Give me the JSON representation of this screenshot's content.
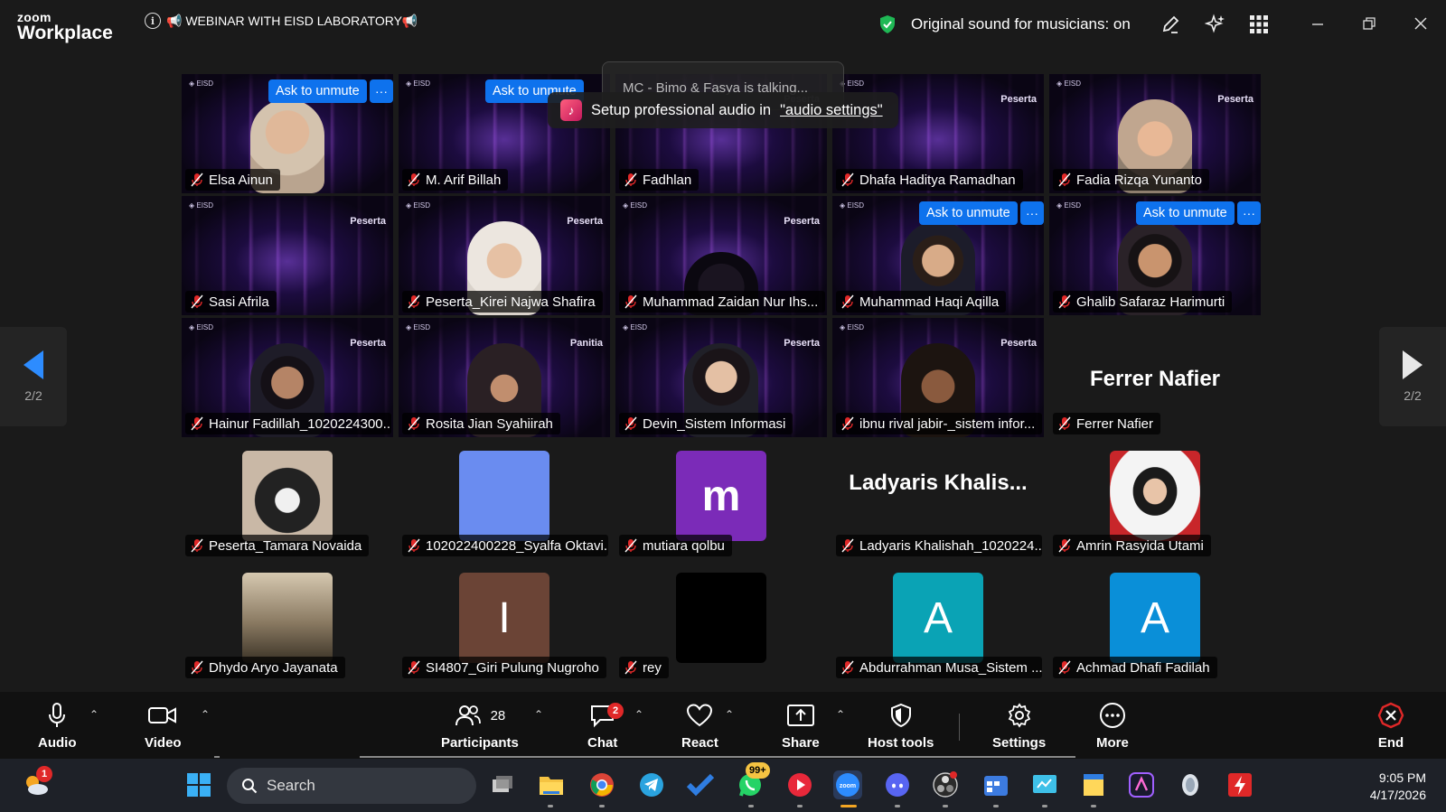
{
  "app": {
    "brand_top": "zoom",
    "brand_bottom": "Workplace"
  },
  "meeting": {
    "title": "📢 WEBINAR WITH EISD LABORATORY📢",
    "sound_status": "Original sound for musicians: on"
  },
  "tile_labels": {
    "brand": "Peserta",
    "brand_alt": "Panitia",
    "ask": "Ask to unmute",
    "more": "···"
  },
  "grid": [
    {
      "name": "Elsa Ainun",
      "ask": true
    },
    {
      "name": "M. Arif Billah",
      "ask": true
    },
    {
      "name": "Fadhlan",
      "ask": false
    },
    {
      "name": "Dhafa Haditya Ramadhan",
      "ask": false
    },
    {
      "name": "Fadia Rizqa Yunanto",
      "ask": false
    },
    {
      "name": "Sasi Afrila",
      "ask": false
    },
    {
      "name": "Peserta_Kirei Najwa Shafira",
      "ask": false
    },
    {
      "name": "Muhammad Zaidan Nur Ihs...",
      "ask": false
    },
    {
      "name": "Muhammad Haqi Aqilla",
      "ask": true
    },
    {
      "name": "Ghalib Safaraz Harimurti",
      "ask": true
    },
    {
      "name": "Hainur Fadillah_1020224300...",
      "ask": false
    },
    {
      "name": "Rosita Jian Syahiirah",
      "ask": false
    },
    {
      "name": "Devin_Sistem Informasi",
      "ask": false
    },
    {
      "name": "ibnu rival jabir-_sistem infor...",
      "ask": false
    },
    {
      "name": "Ferrer Nafier",
      "ask": false,
      "display_name": "Ferrer Nafier"
    }
  ],
  "avatars": [
    {
      "name": "Peserta_Tamara Novaida",
      "letter": "",
      "color": "#6b5a4a"
    },
    {
      "name": "102022400228_Syalfa Oktavi...",
      "letter": "",
      "color": "#6a8cf0"
    },
    {
      "name": "mutiara qolbu",
      "letter": "m",
      "color": "#7b2bb8"
    },
    {
      "name": "Ladyaris Khalishah_1020224...",
      "letter": "",
      "color": "",
      "display_name": "Ladyaris  Khalis..."
    },
    {
      "name": "Amrin Rasyida Utami",
      "letter": "",
      "color": "#c8262a"
    },
    {
      "name": "Dhydo Aryo Jayanata",
      "letter": "",
      "color": "#8a7a62"
    },
    {
      "name": "SI4807_Giri Pulung Nugroho",
      "letter": "I",
      "color": "#6b4436"
    },
    {
      "name": "rey",
      "letter": "",
      "color": "#000000"
    },
    {
      "name": "Abdurrahman Musa_Sistem ...",
      "letter": "A",
      "color": "#0aa3b5"
    },
    {
      "name": "Achmad Dhafi Fadilah",
      "letter": "A",
      "color": "#0a8fd8"
    }
  ],
  "pager": {
    "left": "2/2",
    "right": "2/2"
  },
  "toasts": {
    "talking": "MC - Bimo & Fasya is talking...",
    "audio_prefix": "Setup professional audio in",
    "audio_link": "\"audio settings\""
  },
  "toolbar": {
    "audio": "Audio",
    "video": "Video",
    "participants": "Participants",
    "participants_count": "28",
    "chat": "Chat",
    "chat_badge": "2",
    "react": "React",
    "share": "Share",
    "host_tools": "Host tools",
    "settings": "Settings",
    "more": "More",
    "end": "End"
  },
  "taskbar": {
    "search_placeholder": "Search",
    "time": "9:05 PM",
    "date": "4/17/2026",
    "weather_badge": "1",
    "whatsapp_badge": "99+"
  },
  "colors": {
    "accent": "#0e72ed",
    "end": "#e02828",
    "shield": "#1fb855"
  }
}
